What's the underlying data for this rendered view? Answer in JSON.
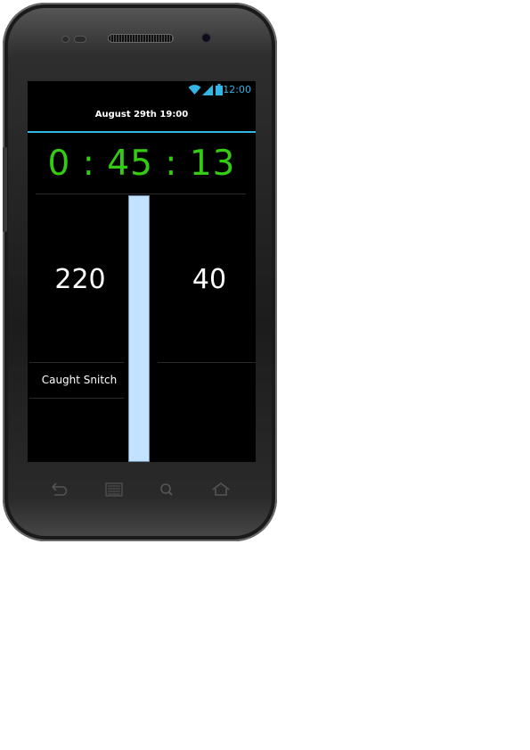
{
  "status_bar": {
    "time": "12:00",
    "icons": [
      "wifi-icon",
      "signal-icon",
      "battery-icon"
    ]
  },
  "header": {
    "title": "August 29th 19:00"
  },
  "timer": {
    "display": "0 : 45 : 13"
  },
  "scores": {
    "left": "220",
    "right": "40"
  },
  "actions": {
    "caught_snitch_label": "Caught Snitch"
  },
  "nav_bar": {
    "buttons": [
      "back-icon",
      "menu-icon",
      "search-icon",
      "home-icon"
    ]
  },
  "colors": {
    "accent": "#33b5e5",
    "timer": "#33cc11",
    "center_bar": "#c2e2ff",
    "screen_bg": "#000000"
  }
}
